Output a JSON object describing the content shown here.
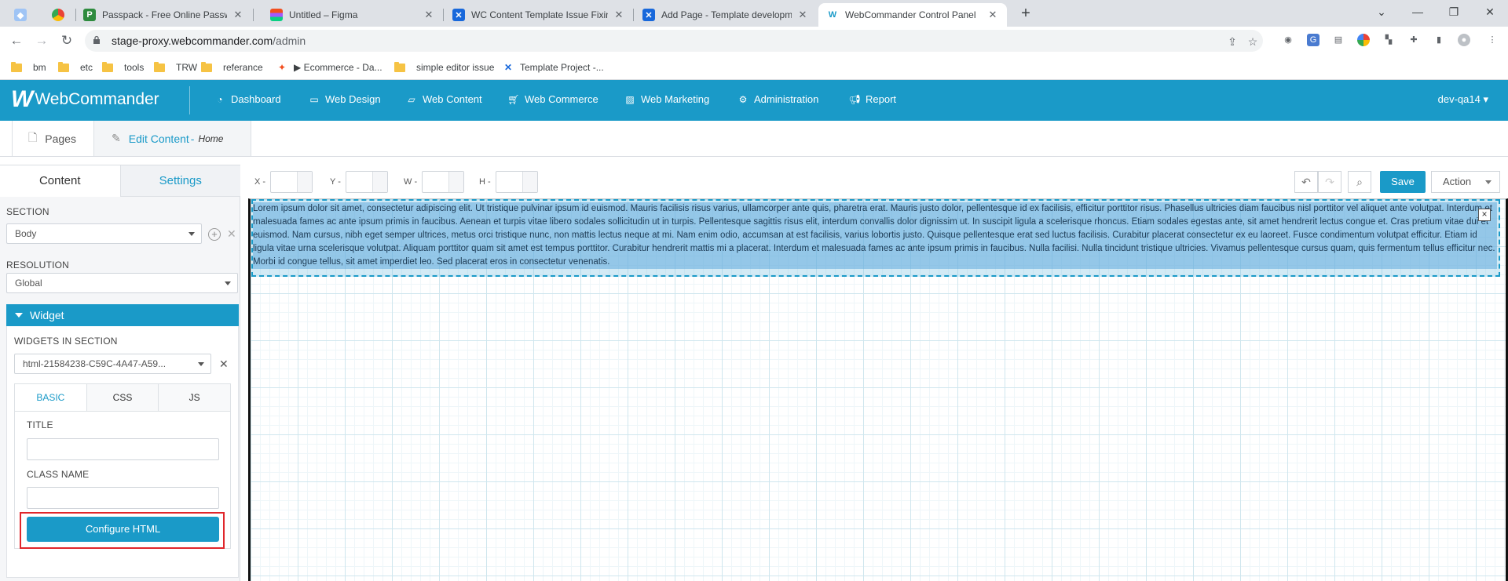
{
  "browser": {
    "tabs": [
      {
        "title": "",
        "icon": "extension-icon"
      },
      {
        "title": "",
        "icon": "chrome-apps-icon"
      },
      {
        "title": "Passpack - Free Online Password",
        "icon": "passpack-icon"
      },
      {
        "title": "Untitled – Figma",
        "icon": "figma-icon"
      },
      {
        "title": "WC Content Template Issue Fixin",
        "icon": "confluence-icon"
      },
      {
        "title": "Add Page - Template developme",
        "icon": "confluence-icon"
      },
      {
        "title": "WebCommander Control Panel",
        "icon": "webcommander-icon"
      }
    ],
    "new_tab": "+",
    "address": {
      "host": "stage-proxy.webcommander.com",
      "path": "/admin"
    },
    "bookmarks": [
      {
        "label": "bm",
        "icon": "folder-icon"
      },
      {
        "label": "etc",
        "icon": "folder-icon"
      },
      {
        "label": "tools",
        "icon": "folder-icon"
      },
      {
        "label": "TRW",
        "icon": "folder-icon"
      },
      {
        "label": "referance",
        "icon": "folder-icon"
      },
      {
        "label": "▶ Ecommerce - Da...",
        "icon": "figma-icon"
      },
      {
        "label": "simple editor issue",
        "icon": "folder-icon"
      },
      {
        "label": "Template Project -...",
        "icon": "confluence-icon"
      }
    ]
  },
  "app": {
    "brand": "WebCommander",
    "menu": [
      "Dashboard",
      "Web Design",
      "Web Content",
      "Web Commerce",
      "Web Marketing",
      "Administration",
      "Report"
    ],
    "user": "dev-qa14"
  },
  "breadcrumb": {
    "pages": "Pages",
    "edit": "Edit Content",
    "edit_sub": "Home"
  },
  "left_panel": {
    "tabs": [
      "Content",
      "Settings"
    ],
    "section_label": "SECTION",
    "section_value": "Body",
    "resolution_label": "RESOLUTION",
    "resolution_value": "Global",
    "widget_title": "Widget",
    "widgets_in_section_label": "WIDGETS IN SECTION",
    "widget_value": "html-21584238-C59C-4A47-A59...",
    "inner_tabs": [
      "BASIC",
      "CSS",
      "JS"
    ],
    "title_label": "TITLE",
    "title_value": "",
    "class_label": "CLASS NAME",
    "class_value": "",
    "configure_button": "Configure HTML"
  },
  "toolbar": {
    "x_label": "X -",
    "y_label": "Y -",
    "w_label": "W -",
    "h_label": "H -",
    "x_value": "",
    "y_value": "",
    "w_value": "",
    "h_value": "",
    "save": "Save",
    "action": "Action"
  },
  "canvas": {
    "text": "Lorem ipsum dolor sit amet, consectetur adipiscing elit. Ut tristique pulvinar ipsum id euismod. Mauris facilisis risus varius, ullamcorper ante quis, pharetra erat. Mauris justo dolor, pellentesque id ex facilisis, efficitur porttitor risus. Phasellus ultricies diam faucibus nisl porttitor vel aliquet ante volutpat. Interdum et malesuada fames ac ante ipsum primis in faucibus. Aenean et turpis vitae libero sodales sollicitudin ut in turpis. Pellentesque sagittis risus elit, interdum convallis dolor dignissim ut. In suscipit ligula a scelerisque rhoncus. Etiam sodales egestas ante, sit amet hendrerit lectus congue et. Cras pretium vitae dui et euismod. Nam cursus, nibh eget semper ultrices, metus orci tristique nunc, non mattis lectus neque at mi. Nam enim odio, accumsan at est facilisis, varius lobortis justo. Quisque pellentesque erat sed luctus facilisis. Curabitur placerat consectetur ex eu laoreet. Fusce condimentum volutpat efficitur. Etiam id ligula vitae urna scelerisque volutpat. Aliquam porttitor quam sit amet est tempus porttitor. Curabitur hendrerit mattis mi a placerat. Interdum et malesuada fames ac ante ipsum primis in faucibus. Nulla facilisi. Nulla tincidunt tristique ultricies. Vivamus pellentesque cursus quam, quis fermentum tellus efficitur nec. Morbi id congue tellus, sit amet imperdiet leo. Sed placerat eros in consectetur venenatis.",
    "close_glyph": "×"
  },
  "colors": {
    "accent": "#1a9ac8",
    "highlight": "#e0262b",
    "tab_bar": "#dee1e5"
  }
}
